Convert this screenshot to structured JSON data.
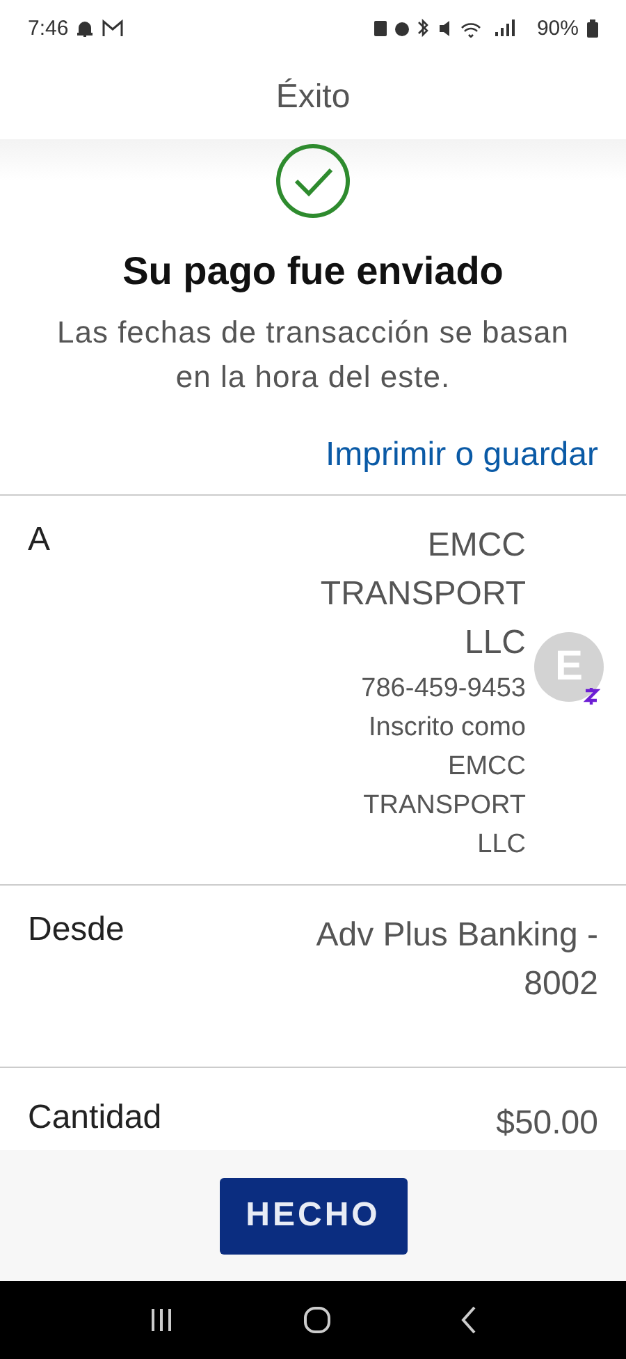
{
  "status_bar": {
    "time": "7:46",
    "battery": "90%"
  },
  "header": {
    "title": "Éxito"
  },
  "confirmation": {
    "title": "Su pago fue enviado",
    "message": "Las fechas de transacción se basan en la hora del este.",
    "link": "Imprimir o guardar"
  },
  "details": [
    {
      "kind": "recipient",
      "label": "A",
      "name": "EMCC TRANSPORT LLC",
      "phone": "786-459-9453",
      "note": "Inscrito como EMCC TRANSPORT LLC",
      "avatar": "E"
    },
    {
      "kind": "plain",
      "label": "Desde",
      "value": "Adv Plus Banking - 8002"
    },
    {
      "kind": "plain",
      "label": "Cantidad",
      "value": "$50.00"
    }
  ],
  "footer": {
    "button": "HECHO"
  }
}
